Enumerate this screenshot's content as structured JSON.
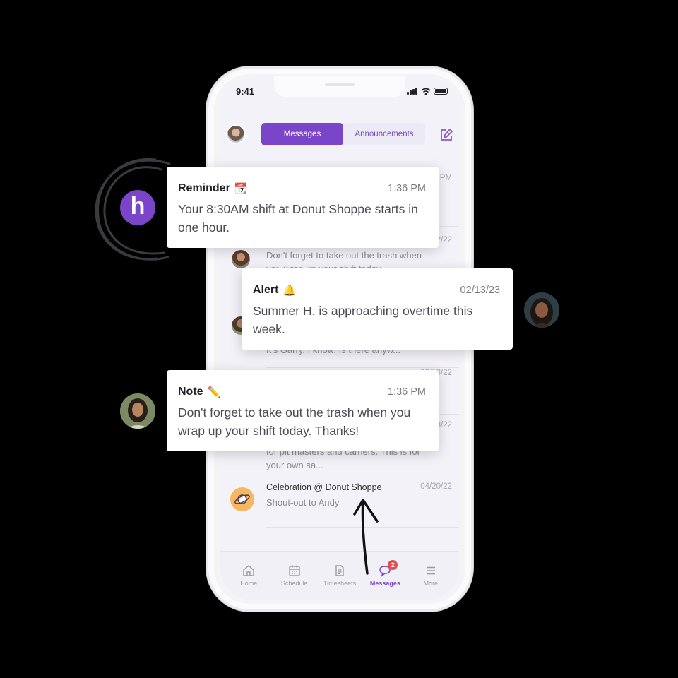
{
  "status_bar": {
    "time": "9:41"
  },
  "header": {
    "tabs": [
      {
        "label": "Messages",
        "active": true
      },
      {
        "label": "Announcements",
        "active": false
      }
    ]
  },
  "messages": [
    {
      "title": "",
      "date": "PM",
      "preview": ""
    },
    {
      "title": "",
      "date": "2/22",
      "preview": "Don't forget to take out the trash when you wrap up your shift today."
    },
    {
      "title": "",
      "date": "",
      "preview": "It's Garry. I know. Is there anyw..."
    },
    {
      "title": "",
      "date": "02/13/22",
      "preview": ""
    },
    {
      "title": "",
      "date": "3/22",
      "preview": "for pit masters and carriers. This is for your own sa..."
    },
    {
      "title": "Celebration @ Donut Shoppe",
      "date": "04/20/22",
      "preview": "Shout-out to Andy"
    }
  ],
  "tabbar": {
    "items": [
      {
        "label": "Home",
        "icon": "home-icon"
      },
      {
        "label": "Schedule",
        "icon": "calendar-icon"
      },
      {
        "label": "Timesheets",
        "icon": "document-icon"
      },
      {
        "label": "Messages",
        "icon": "chat-icon",
        "active": true,
        "badge": "2"
      },
      {
        "label": "More",
        "icon": "menu-icon"
      }
    ]
  },
  "notifications": [
    {
      "title": "Reminder",
      "emoji": "📆",
      "time": "1:36 PM",
      "body": "Your 8:30AM shift at Donut Shoppe starts in one hour."
    },
    {
      "title": "Alert",
      "emoji": "🔔",
      "time": "02/13/23",
      "body": "Summer H. is approaching overtime this week."
    },
    {
      "title": "Note",
      "emoji": "✏️",
      "time": "1:36 PM",
      "body": "Don't forget to take out the trash when you wrap up your shift today. Thanks!"
    }
  ],
  "brand": {
    "logo_letter": "h",
    "accent": "#7b45c9"
  }
}
